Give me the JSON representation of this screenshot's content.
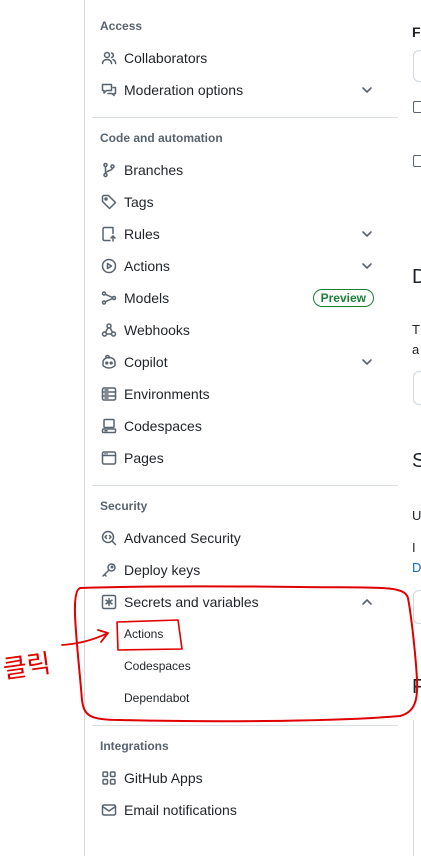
{
  "sidebar": {
    "access": {
      "title": "Access",
      "items": [
        {
          "label": "Collaborators",
          "icon": "people-icon"
        },
        {
          "label": "Moderation options",
          "icon": "comment-discussion-icon",
          "expandable": true
        }
      ]
    },
    "code": {
      "title": "Code and automation",
      "items": [
        {
          "label": "Branches",
          "icon": "git-branch-icon"
        },
        {
          "label": "Tags",
          "icon": "tag-icon"
        },
        {
          "label": "Rules",
          "icon": "repo-push-icon",
          "expandable": true
        },
        {
          "label": "Actions",
          "icon": "play-icon",
          "expandable": true
        },
        {
          "label": "Models",
          "icon": "models-icon",
          "badge": "Preview"
        },
        {
          "label": "Webhooks",
          "icon": "webhook-icon"
        },
        {
          "label": "Copilot",
          "icon": "copilot-icon",
          "expandable": true
        },
        {
          "label": "Environments",
          "icon": "server-icon"
        },
        {
          "label": "Codespaces",
          "icon": "codespaces-icon"
        },
        {
          "label": "Pages",
          "icon": "browser-icon"
        }
      ]
    },
    "security": {
      "title": "Security",
      "items": [
        {
          "label": "Advanced Security",
          "icon": "codescan-icon"
        },
        {
          "label": "Deploy keys",
          "icon": "key-icon"
        },
        {
          "label": "Secrets and variables",
          "icon": "key-asterisk-icon",
          "expanded": true
        }
      ],
      "subitems": [
        "Actions",
        "Codespaces",
        "Dependabot"
      ]
    },
    "integrations": {
      "title": "Integrations",
      "items": [
        {
          "label": "GitHub Apps",
          "icon": "apps-icon"
        },
        {
          "label": "Email notifications",
          "icon": "mail-icon"
        }
      ]
    }
  },
  "annotation": {
    "handwritten_text": "클릭",
    "color": "#e00000"
  },
  "right_panel_fragments": [
    "F",
    "D",
    "T",
    "a",
    "S",
    "U",
    "I",
    "D",
    "F"
  ],
  "colors": {
    "accent_green": "#1a7f37",
    "muted": "#59636e",
    "border": "#d0d7de",
    "link": "#0969da"
  }
}
